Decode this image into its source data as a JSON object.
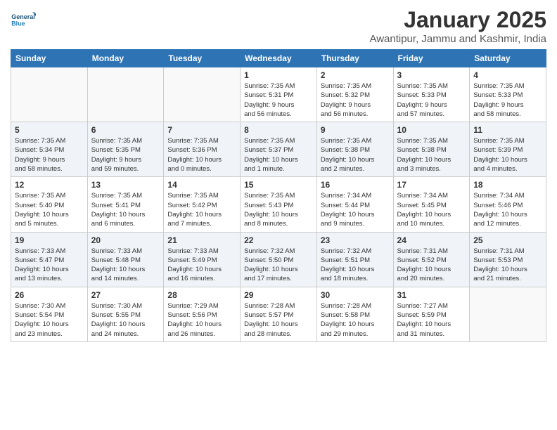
{
  "header": {
    "logo_line1": "General",
    "logo_line2": "Blue",
    "title": "January 2025",
    "subtitle": "Awantipur, Jammu and Kashmir, India"
  },
  "weekdays": [
    "Sunday",
    "Monday",
    "Tuesday",
    "Wednesday",
    "Thursday",
    "Friday",
    "Saturday"
  ],
  "weeks": [
    [
      {
        "day": "",
        "info": ""
      },
      {
        "day": "",
        "info": ""
      },
      {
        "day": "",
        "info": ""
      },
      {
        "day": "1",
        "info": "Sunrise: 7:35 AM\nSunset: 5:31 PM\nDaylight: 9 hours\nand 56 minutes."
      },
      {
        "day": "2",
        "info": "Sunrise: 7:35 AM\nSunset: 5:32 PM\nDaylight: 9 hours\nand 56 minutes."
      },
      {
        "day": "3",
        "info": "Sunrise: 7:35 AM\nSunset: 5:33 PM\nDaylight: 9 hours\nand 57 minutes."
      },
      {
        "day": "4",
        "info": "Sunrise: 7:35 AM\nSunset: 5:33 PM\nDaylight: 9 hours\nand 58 minutes."
      }
    ],
    [
      {
        "day": "5",
        "info": "Sunrise: 7:35 AM\nSunset: 5:34 PM\nDaylight: 9 hours\nand 58 minutes."
      },
      {
        "day": "6",
        "info": "Sunrise: 7:35 AM\nSunset: 5:35 PM\nDaylight: 9 hours\nand 59 minutes."
      },
      {
        "day": "7",
        "info": "Sunrise: 7:35 AM\nSunset: 5:36 PM\nDaylight: 10 hours\nand 0 minutes."
      },
      {
        "day": "8",
        "info": "Sunrise: 7:35 AM\nSunset: 5:37 PM\nDaylight: 10 hours\nand 1 minute."
      },
      {
        "day": "9",
        "info": "Sunrise: 7:35 AM\nSunset: 5:38 PM\nDaylight: 10 hours\nand 2 minutes."
      },
      {
        "day": "10",
        "info": "Sunrise: 7:35 AM\nSunset: 5:38 PM\nDaylight: 10 hours\nand 3 minutes."
      },
      {
        "day": "11",
        "info": "Sunrise: 7:35 AM\nSunset: 5:39 PM\nDaylight: 10 hours\nand 4 minutes."
      }
    ],
    [
      {
        "day": "12",
        "info": "Sunrise: 7:35 AM\nSunset: 5:40 PM\nDaylight: 10 hours\nand 5 minutes."
      },
      {
        "day": "13",
        "info": "Sunrise: 7:35 AM\nSunset: 5:41 PM\nDaylight: 10 hours\nand 6 minutes."
      },
      {
        "day": "14",
        "info": "Sunrise: 7:35 AM\nSunset: 5:42 PM\nDaylight: 10 hours\nand 7 minutes."
      },
      {
        "day": "15",
        "info": "Sunrise: 7:35 AM\nSunset: 5:43 PM\nDaylight: 10 hours\nand 8 minutes."
      },
      {
        "day": "16",
        "info": "Sunrise: 7:34 AM\nSunset: 5:44 PM\nDaylight: 10 hours\nand 9 minutes."
      },
      {
        "day": "17",
        "info": "Sunrise: 7:34 AM\nSunset: 5:45 PM\nDaylight: 10 hours\nand 10 minutes."
      },
      {
        "day": "18",
        "info": "Sunrise: 7:34 AM\nSunset: 5:46 PM\nDaylight: 10 hours\nand 12 minutes."
      }
    ],
    [
      {
        "day": "19",
        "info": "Sunrise: 7:33 AM\nSunset: 5:47 PM\nDaylight: 10 hours\nand 13 minutes."
      },
      {
        "day": "20",
        "info": "Sunrise: 7:33 AM\nSunset: 5:48 PM\nDaylight: 10 hours\nand 14 minutes."
      },
      {
        "day": "21",
        "info": "Sunrise: 7:33 AM\nSunset: 5:49 PM\nDaylight: 10 hours\nand 16 minutes."
      },
      {
        "day": "22",
        "info": "Sunrise: 7:32 AM\nSunset: 5:50 PM\nDaylight: 10 hours\nand 17 minutes."
      },
      {
        "day": "23",
        "info": "Sunrise: 7:32 AM\nSunset: 5:51 PM\nDaylight: 10 hours\nand 18 minutes."
      },
      {
        "day": "24",
        "info": "Sunrise: 7:31 AM\nSunset: 5:52 PM\nDaylight: 10 hours\nand 20 minutes."
      },
      {
        "day": "25",
        "info": "Sunrise: 7:31 AM\nSunset: 5:53 PM\nDaylight: 10 hours\nand 21 minutes."
      }
    ],
    [
      {
        "day": "26",
        "info": "Sunrise: 7:30 AM\nSunset: 5:54 PM\nDaylight: 10 hours\nand 23 minutes."
      },
      {
        "day": "27",
        "info": "Sunrise: 7:30 AM\nSunset: 5:55 PM\nDaylight: 10 hours\nand 24 minutes."
      },
      {
        "day": "28",
        "info": "Sunrise: 7:29 AM\nSunset: 5:56 PM\nDaylight: 10 hours\nand 26 minutes."
      },
      {
        "day": "29",
        "info": "Sunrise: 7:28 AM\nSunset: 5:57 PM\nDaylight: 10 hours\nand 28 minutes."
      },
      {
        "day": "30",
        "info": "Sunrise: 7:28 AM\nSunset: 5:58 PM\nDaylight: 10 hours\nand 29 minutes."
      },
      {
        "day": "31",
        "info": "Sunrise: 7:27 AM\nSunset: 5:59 PM\nDaylight: 10 hours\nand 31 minutes."
      },
      {
        "day": "",
        "info": ""
      }
    ]
  ]
}
